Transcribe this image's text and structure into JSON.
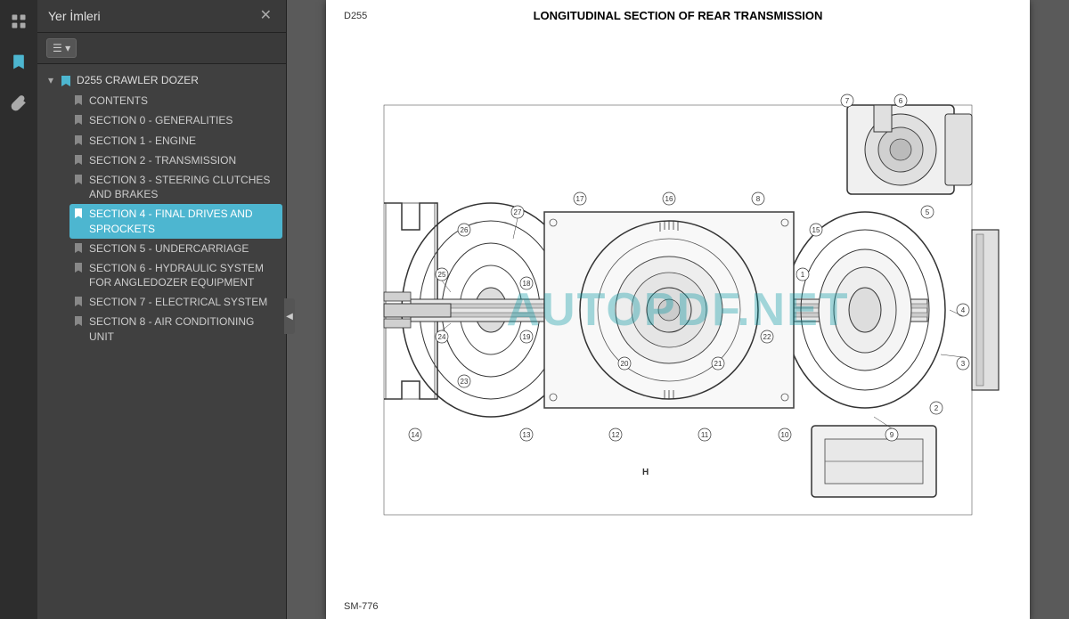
{
  "toolbar": {
    "icons": [
      {
        "name": "pages-icon",
        "symbol": "⊞",
        "tooltip": "Pages"
      },
      {
        "name": "bookmarks-icon",
        "symbol": "🔖",
        "tooltip": "Bookmarks",
        "active": true
      },
      {
        "name": "attachments-icon",
        "symbol": "📎",
        "tooltip": "Attachments"
      }
    ]
  },
  "sidebar": {
    "title": "Yer İmleri",
    "close_label": "✕",
    "tool_button_label": "☰ ▾",
    "tree": {
      "root_label": "D255 CRAWLER DOZER",
      "items": [
        {
          "id": "contents",
          "label": "CONTENTS",
          "active": false
        },
        {
          "id": "section0",
          "label": "SECTION 0 - GENERALITIES",
          "active": false
        },
        {
          "id": "section1",
          "label": "SECTION 1 - ENGINE",
          "active": false
        },
        {
          "id": "section2",
          "label": "SECTION 2 - TRANSMISSION",
          "active": false
        },
        {
          "id": "section3",
          "label": "SECTION 3 - STEERING CLUTCHES AND BRAKES",
          "active": false
        },
        {
          "id": "section4",
          "label": "SECTION 4 - FINAL DRIVES AND SPROCKETS",
          "active": true
        },
        {
          "id": "section5",
          "label": "SECTION 5 - UNDERCARRIAGE",
          "active": false
        },
        {
          "id": "section6",
          "label": "SECTION 6 - HYDRAULIC SYSTEM FOR ANGLEDOZER EQUIPMENT",
          "active": false
        },
        {
          "id": "section7",
          "label": "SECTION 7 - ELECTRICAL SYSTEM",
          "active": false
        },
        {
          "id": "section8",
          "label": "SECTION 8 - AIR CONDITIONING UNIT",
          "active": false
        }
      ]
    }
  },
  "main": {
    "page_id": "D255",
    "title": "LONGITUDINAL SECTION OF REAR TRANSMISSION",
    "watermark": "AUTOPDF.NET",
    "caption": "SM-776"
  }
}
